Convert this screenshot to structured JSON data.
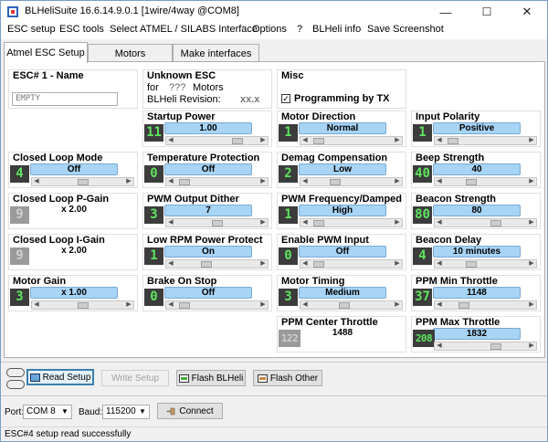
{
  "window": {
    "title": "BLHeliSuite 16.6.14.9.0.1  [1wire/4way @COM8]",
    "min": "—",
    "max": "☐",
    "close": "✕"
  },
  "menu": [
    "ESC setup",
    "ESC tools",
    "Select ATMEL / SILABS Interface",
    "Options",
    "?",
    "BLHeli info",
    "Save Screenshot"
  ],
  "tabs": [
    "Atmel ESC Setup",
    "Motors",
    "Make interfaces"
  ],
  "esc_name": {
    "title": "ESC# 1 - Name",
    "value": "EMPTY"
  },
  "esc_info": {
    "title": "Unknown ESC",
    "for_label": "for",
    "motors_value": "???",
    "motors_label": "Motors",
    "revision_label": "BLHeli Revision:",
    "revision_value": "xx.x"
  },
  "misc": {
    "title": "Misc",
    "prog_by_tx": "Programming by TX"
  },
  "params": {
    "startup_power": {
      "title": "Startup Power",
      "value": "1.00",
      "num": "11"
    },
    "motor_direction": {
      "title": "Motor Direction",
      "value": "Normal",
      "num": "1"
    },
    "input_polarity": {
      "title": "Input Polarity",
      "value": "Positive",
      "num": "1"
    },
    "closed_loop_mode": {
      "title": "Closed Loop Mode",
      "value": "Off",
      "num": "4"
    },
    "temp_protection": {
      "title": "Temperature Protection",
      "value": "Off",
      "num": "0"
    },
    "demag_comp": {
      "title": "Demag Compensation",
      "value": "Low",
      "num": "2"
    },
    "beep_strength": {
      "title": "Beep Strength",
      "value": "40",
      "num": "40"
    },
    "p_gain": {
      "title": "Closed Loop P-Gain",
      "value": "x 2.00",
      "num": "9"
    },
    "pwm_dither": {
      "title": "PWM Output Dither",
      "value": "7",
      "num": "3"
    },
    "pwm_freq": {
      "title": "PWM Frequency/Damped",
      "value": "High",
      "num": "1"
    },
    "beacon_strength": {
      "title": "Beacon Strength",
      "value": "80",
      "num": "80"
    },
    "i_gain": {
      "title": "Closed Loop I-Gain",
      "value": "x 2.00",
      "num": "9"
    },
    "low_rpm": {
      "title": "Low RPM Power Protect",
      "value": "On",
      "num": "1"
    },
    "pwm_input": {
      "title": "Enable PWM Input",
      "value": "Off",
      "num": "0"
    },
    "beacon_delay": {
      "title": "Beacon Delay",
      "value": "10 minutes",
      "num": "4"
    },
    "motor_gain": {
      "title": "Motor Gain",
      "value": "x 1.00",
      "num": "3"
    },
    "brake_on_stop": {
      "title": "Brake On Stop",
      "value": "Off",
      "num": "0"
    },
    "motor_timing": {
      "title": "Motor Timing",
      "value": "Medium",
      "num": "3"
    },
    "ppm_min": {
      "title": "PPM Min Throttle",
      "value": "1148",
      "num": "37"
    },
    "ppm_center": {
      "title": "PPM Center Throttle",
      "value": "1488",
      "num": "122"
    },
    "ppm_max": {
      "title": "PPM Max Throttle",
      "value": "1832",
      "num": "208"
    }
  },
  "buttons": {
    "read": "Read Setup",
    "write": "Write Setup",
    "flash_blheli": "Flash BLHeli",
    "flash_other": "Flash Other",
    "connect": "Connect"
  },
  "connection": {
    "port_label": "Port:",
    "port_value": "COM 8",
    "baud_label": "Baud:",
    "baud_value": "115200"
  },
  "status": "ESC#4 setup read successfully",
  "colors": {
    "value_bg": "#a8d4f6",
    "num_fg": "#5fe45f",
    "num_bg": "#3c3c3c"
  }
}
